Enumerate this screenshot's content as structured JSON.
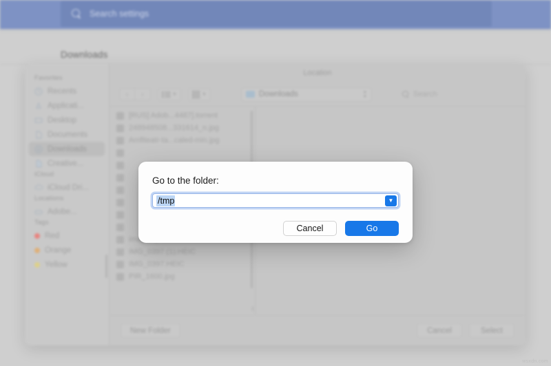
{
  "settings_bar": {
    "search_icon": "search-icon",
    "search_placeholder": "Search settings",
    "bar_color": "#7e92c4",
    "field_color": "#7287b9"
  },
  "page": {
    "heading": "Downloads",
    "watermark": "wsxdn.com"
  },
  "finder": {
    "window_title": "Location",
    "toolbar": {
      "back_icon": "chevron-left-icon",
      "forward_icon": "chevron-right-icon",
      "view_icon": "column-view-icon",
      "view_caret": "chevron-down-icon",
      "group_icon": "grid-view-icon",
      "group_caret": "chevron-down-icon",
      "location_label": "Downloads",
      "location_folder_icon": "folder-icon",
      "location_stepper_icon": "stepper-icon",
      "search_icon": "search-icon",
      "search_placeholder": "Search"
    },
    "sidebar": {
      "groups": [
        {
          "title": "Favorites",
          "items": [
            {
              "label": "Recents",
              "icon": "clock-icon",
              "selected": false
            },
            {
              "label": "Applicati...",
              "icon": "applications-icon",
              "selected": false
            },
            {
              "label": "Desktop",
              "icon": "desktop-icon",
              "selected": false
            },
            {
              "label": "Documents",
              "icon": "document-icon",
              "selected": false
            },
            {
              "label": "Downloads",
              "icon": "downloads-icon",
              "selected": true
            },
            {
              "label": "Creative...",
              "icon": "document-icon",
              "selected": false
            }
          ]
        },
        {
          "title": "iCloud",
          "items": [
            {
              "label": "iCloud Dri...",
              "icon": "cloud-icon",
              "selected": false
            }
          ]
        },
        {
          "title": "Locations",
          "items": [
            {
              "label": "Adobe...",
              "icon": "disk-icon",
              "selected": false
            }
          ]
        },
        {
          "title": "Tags",
          "items": [
            {
              "label": "Red",
              "icon": "tag-dot-icon",
              "color": "#e8837f",
              "selected": false
            },
            {
              "label": "Orange",
              "icon": "tag-dot-icon",
              "color": "#dfb079",
              "selected": false
            },
            {
              "label": "Yellow",
              "icon": "tag-dot-icon",
              "color": "#ddd08a",
              "selected": false
            }
          ]
        }
      ]
    },
    "files": [
      {
        "name": "[RUS] Adob...4487].torrent",
        "icon": "torrent-file-icon"
      },
      {
        "name": "248948508...331614_n.jpg",
        "icon": "image-file-icon"
      },
      {
        "name": "Amfiteatr-ta...caled-min.jpg",
        "icon": "image-file-icon"
      },
      {
        "name": "",
        "icon": "file-icon"
      },
      {
        "name": "",
        "icon": "file-icon"
      },
      {
        "name": "",
        "icon": "file-icon"
      },
      {
        "name": "",
        "icon": "file-icon"
      },
      {
        "name": "",
        "icon": "file-icon"
      },
      {
        "name": "",
        "icon": "file-icon"
      },
      {
        "name": "",
        "icon": "file-icon"
      },
      {
        "name": "images.psd",
        "icon": "psd-file-icon"
      },
      {
        "name": "IMG_0397 (1).HEIC",
        "icon": "image-file-icon"
      },
      {
        "name": "IMG_0397.HEIC",
        "icon": "image-file-icon"
      },
      {
        "name": "PIR_1600.jpg",
        "icon": "image-file-icon"
      }
    ],
    "footer": {
      "new_folder_label": "New Folder",
      "cancel_label": "Cancel",
      "select_label": "Select"
    }
  },
  "modal": {
    "label": "Go to the folder:",
    "input_value": "/tmp",
    "dropdown_icon": "chevron-down-icon",
    "cancel_label": "Cancel",
    "go_label": "Go",
    "accent_color": "#1878e8"
  }
}
